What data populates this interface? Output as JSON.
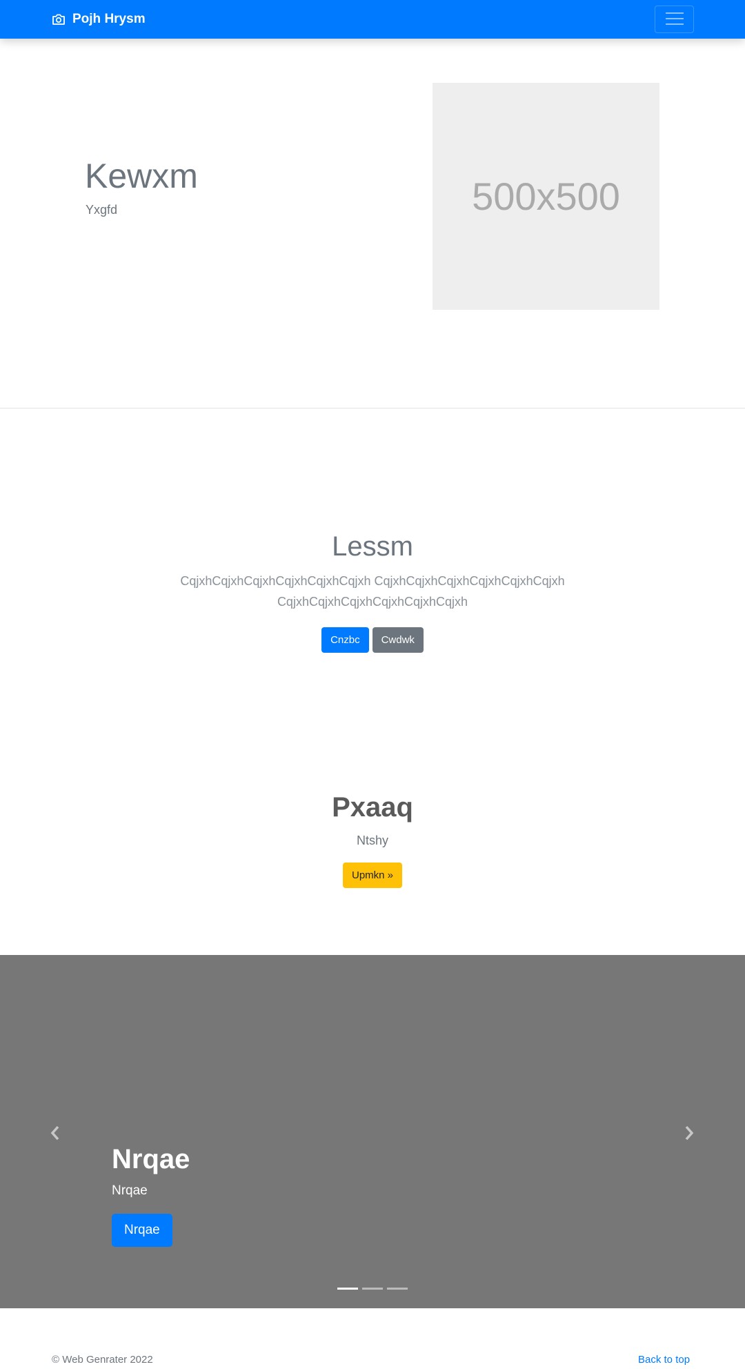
{
  "navbar": {
    "brand_label": "Pojh Hrysm",
    "brand_icon": "camera-icon",
    "toggler_icon": "hamburger-menu-icon",
    "background_color": "#007bff"
  },
  "hero": {
    "title": "Kewxm",
    "subtitle": "Yxgfd",
    "placeholder_text": "500x500"
  },
  "intro": {
    "title": "Lessm",
    "body_line1": "CqjxhCqjxhCqjxhCqjxhCqjxhCqjxh CqjxhCqjxhCqjxhCqjxhCqjxhCqjxh",
    "body_line2": "CqjxhCqjxhCqjxhCqjxhCqjxhCqjxh",
    "primary_button": "Cnzbc",
    "secondary_button": "Cwdwk"
  },
  "feature": {
    "title": "Pxaaq",
    "subtitle": "Ntshy",
    "button": "Upmkn »"
  },
  "carousel": {
    "caption_title": "Nrqae",
    "caption_subtitle": "Nrqae",
    "caption_button": "Nrqae",
    "prev_icon": "chevron-left-icon",
    "next_icon": "chevron-right-icon",
    "slide_count": 3,
    "active_slide": 1
  },
  "footer": {
    "copyright": "© Web Genrater 2022",
    "back_to_top": "Back to top"
  }
}
